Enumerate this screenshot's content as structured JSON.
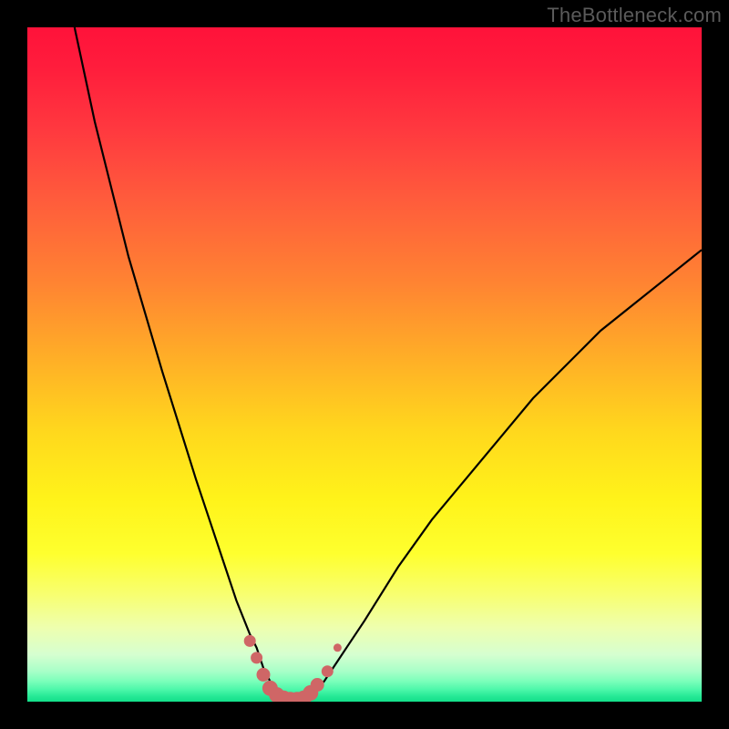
{
  "watermark": "TheBottleneck.com",
  "colors": {
    "frame": "#000000",
    "curve_stroke": "#000000",
    "marker_fill": "#cf6666",
    "marker_stroke": "#cf6666"
  },
  "chart_data": {
    "type": "line",
    "title": "",
    "xlabel": "",
    "ylabel": "",
    "xlim": [
      0,
      100
    ],
    "ylim": [
      0,
      100
    ],
    "grid": false,
    "legend": false,
    "series": [
      {
        "name": "bottleneck-curve",
        "x": [
          7,
          10,
          15,
          20,
          25,
          27,
          29,
          31,
          33,
          34,
          35,
          36,
          37,
          38,
          39,
          40,
          42,
          44,
          46,
          50,
          55,
          60,
          65,
          70,
          75,
          80,
          85,
          90,
          95,
          100
        ],
        "y": [
          100,
          86,
          66,
          49,
          33,
          27,
          21,
          15,
          10,
          8,
          5,
          3,
          1,
          0,
          0,
          0,
          1,
          3,
          6,
          12,
          20,
          27,
          33,
          39,
          45,
          50,
          55,
          59,
          63,
          67
        ]
      }
    ],
    "markers": {
      "name": "minimum-region-markers",
      "points": [
        {
          "x": 33.0,
          "y": 9.0,
          "r": 6
        },
        {
          "x": 34.0,
          "y": 6.5,
          "r": 6
        },
        {
          "x": 35.0,
          "y": 4.0,
          "r": 7
        },
        {
          "x": 36.0,
          "y": 2.0,
          "r": 8
        },
        {
          "x": 37.0,
          "y": 1.0,
          "r": 8
        },
        {
          "x": 38.0,
          "y": 0.5,
          "r": 8
        },
        {
          "x": 39.0,
          "y": 0.3,
          "r": 8
        },
        {
          "x": 40.0,
          "y": 0.3,
          "r": 8
        },
        {
          "x": 41.0,
          "y": 0.5,
          "r": 8
        },
        {
          "x": 42.0,
          "y": 1.3,
          "r": 8
        },
        {
          "x": 43.0,
          "y": 2.5,
          "r": 7
        },
        {
          "x": 44.5,
          "y": 4.5,
          "r": 6
        },
        {
          "x": 46.0,
          "y": 8.0,
          "r": 4
        }
      ]
    }
  }
}
